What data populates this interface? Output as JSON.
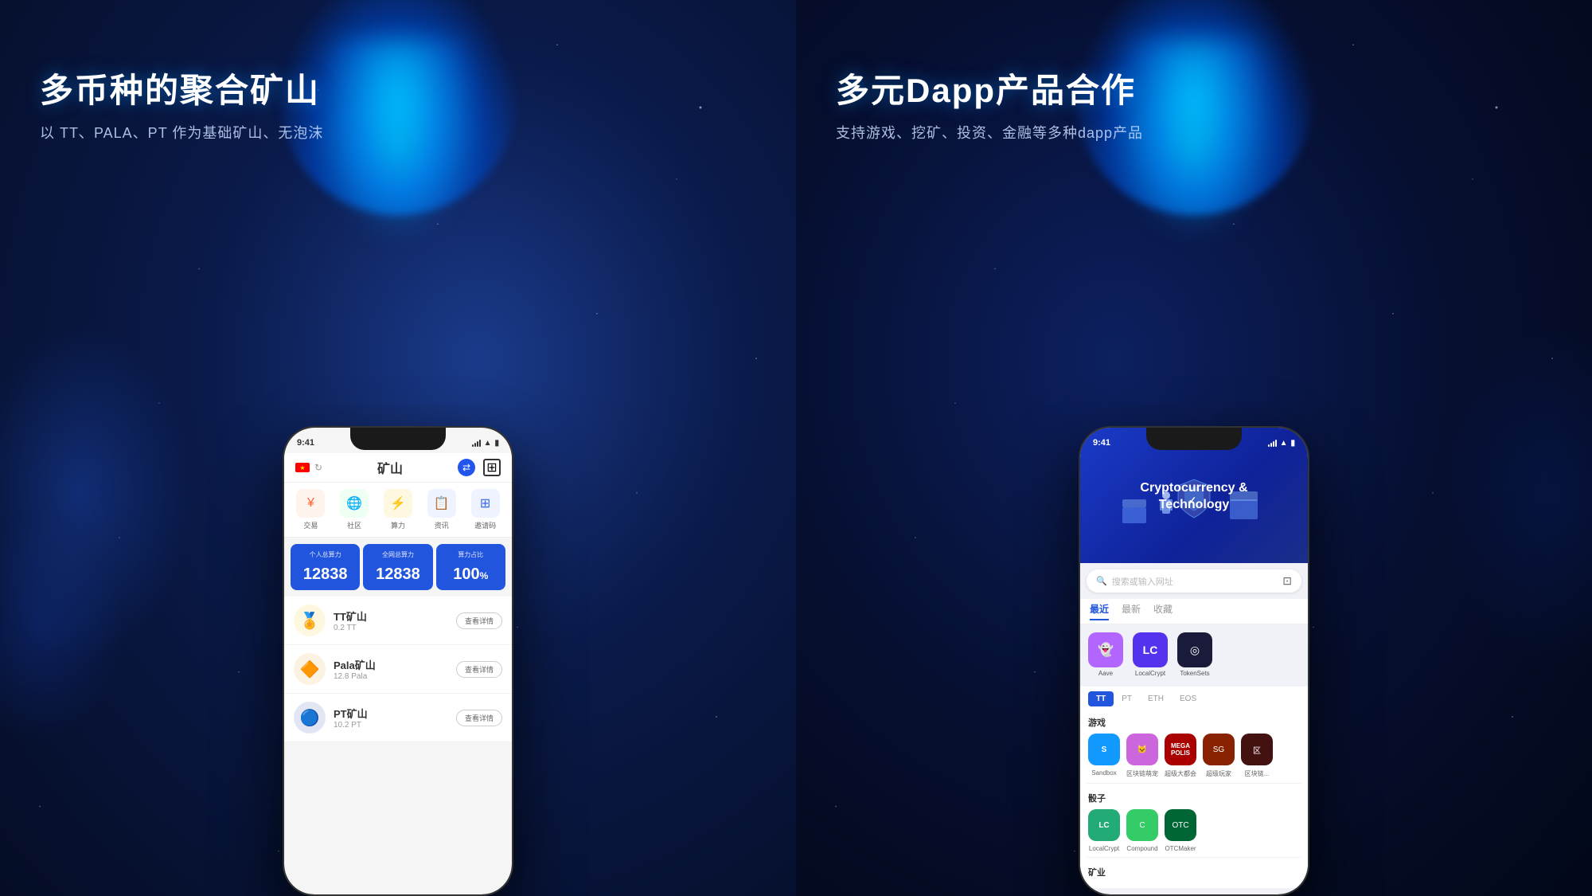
{
  "left_panel": {
    "title": "多币种的聚合矿山",
    "subtitle": "以 TT、PALA、PT 作为基础矿山、无泡沫",
    "phone": {
      "status_time": "9:41",
      "nav_title": "矿山",
      "menu_items": [
        {
          "icon": "¥",
          "label": "交易",
          "color": "#ff6633"
        },
        {
          "icon": "🌐",
          "label": "社区",
          "color": "#33bb55"
        },
        {
          "icon": "⚡",
          "label": "算力",
          "color": "#ffaa00"
        },
        {
          "icon": "📋",
          "label": "资讯",
          "color": "#3366ee"
        },
        {
          "icon": "📷",
          "label": "邀请码",
          "color": "#3366ee"
        }
      ],
      "stats": [
        {
          "label": "个人总算力",
          "value": "12838"
        },
        {
          "label": "全网总算力",
          "value": "12838"
        },
        {
          "label": "算力占比",
          "value": "100",
          "unit": "%"
        }
      ],
      "mines": [
        {
          "name": "TT矿山",
          "sub": "0.2 TT",
          "icon": "🏅",
          "color": "#f5c518"
        },
        {
          "name": "Pala矿山",
          "sub": "12.8 Pala",
          "icon": "🔶",
          "color": "#e8a020"
        },
        {
          "name": "PT矿山",
          "sub": "10.2 PT",
          "icon": "🔵",
          "color": "#2244aa"
        }
      ],
      "mine_btn": "查看详情"
    }
  },
  "right_panel": {
    "title": "多元Dapp产品合作",
    "subtitle": "支持游戏、挖矿、投资、金融等多种dapp产品",
    "phone": {
      "status_time": "9:41",
      "header_title": "Cryptocurrency &",
      "header_title2": "Technology",
      "search_placeholder": "搜索或输入网址",
      "tabs": [
        {
          "label": "最近",
          "active": true
        },
        {
          "label": "最新",
          "active": false
        },
        {
          "label": "收藏",
          "active": false
        }
      ],
      "recent_apps": [
        {
          "name": "Aave",
          "color": "#b366ff"
        },
        {
          "name": "LocalCrypt",
          "color": "#6633ee"
        },
        {
          "name": "TokenSets",
          "color": "#1a1a4a"
        }
      ],
      "chain_tabs": [
        "TT",
        "PT",
        "ETH",
        "EOS"
      ],
      "active_chain": "TT",
      "categories": [
        {
          "label": "游戏",
          "apps": [
            {
              "name": "Sandbox",
              "color": "#1199ff"
            },
            {
              "name": "区块链萌宠",
              "color": "#cc66dd"
            },
            {
              "name": "超级大都会",
              "color": "#aa0000"
            },
            {
              "name": "超级玩家",
              "color": "#882200"
            },
            {
              "name": "区块链...",
              "color": "#441111"
            }
          ]
        },
        {
          "label": "骰子",
          "apps": [
            {
              "name": "LocalCrypt",
              "color": "#22aa77"
            },
            {
              "name": "Compound",
              "color": "#33cc66"
            },
            {
              "name": "OTCMaker",
              "color": "#006633"
            }
          ]
        },
        {
          "label": "矿业",
          "apps": []
        }
      ]
    }
  }
}
